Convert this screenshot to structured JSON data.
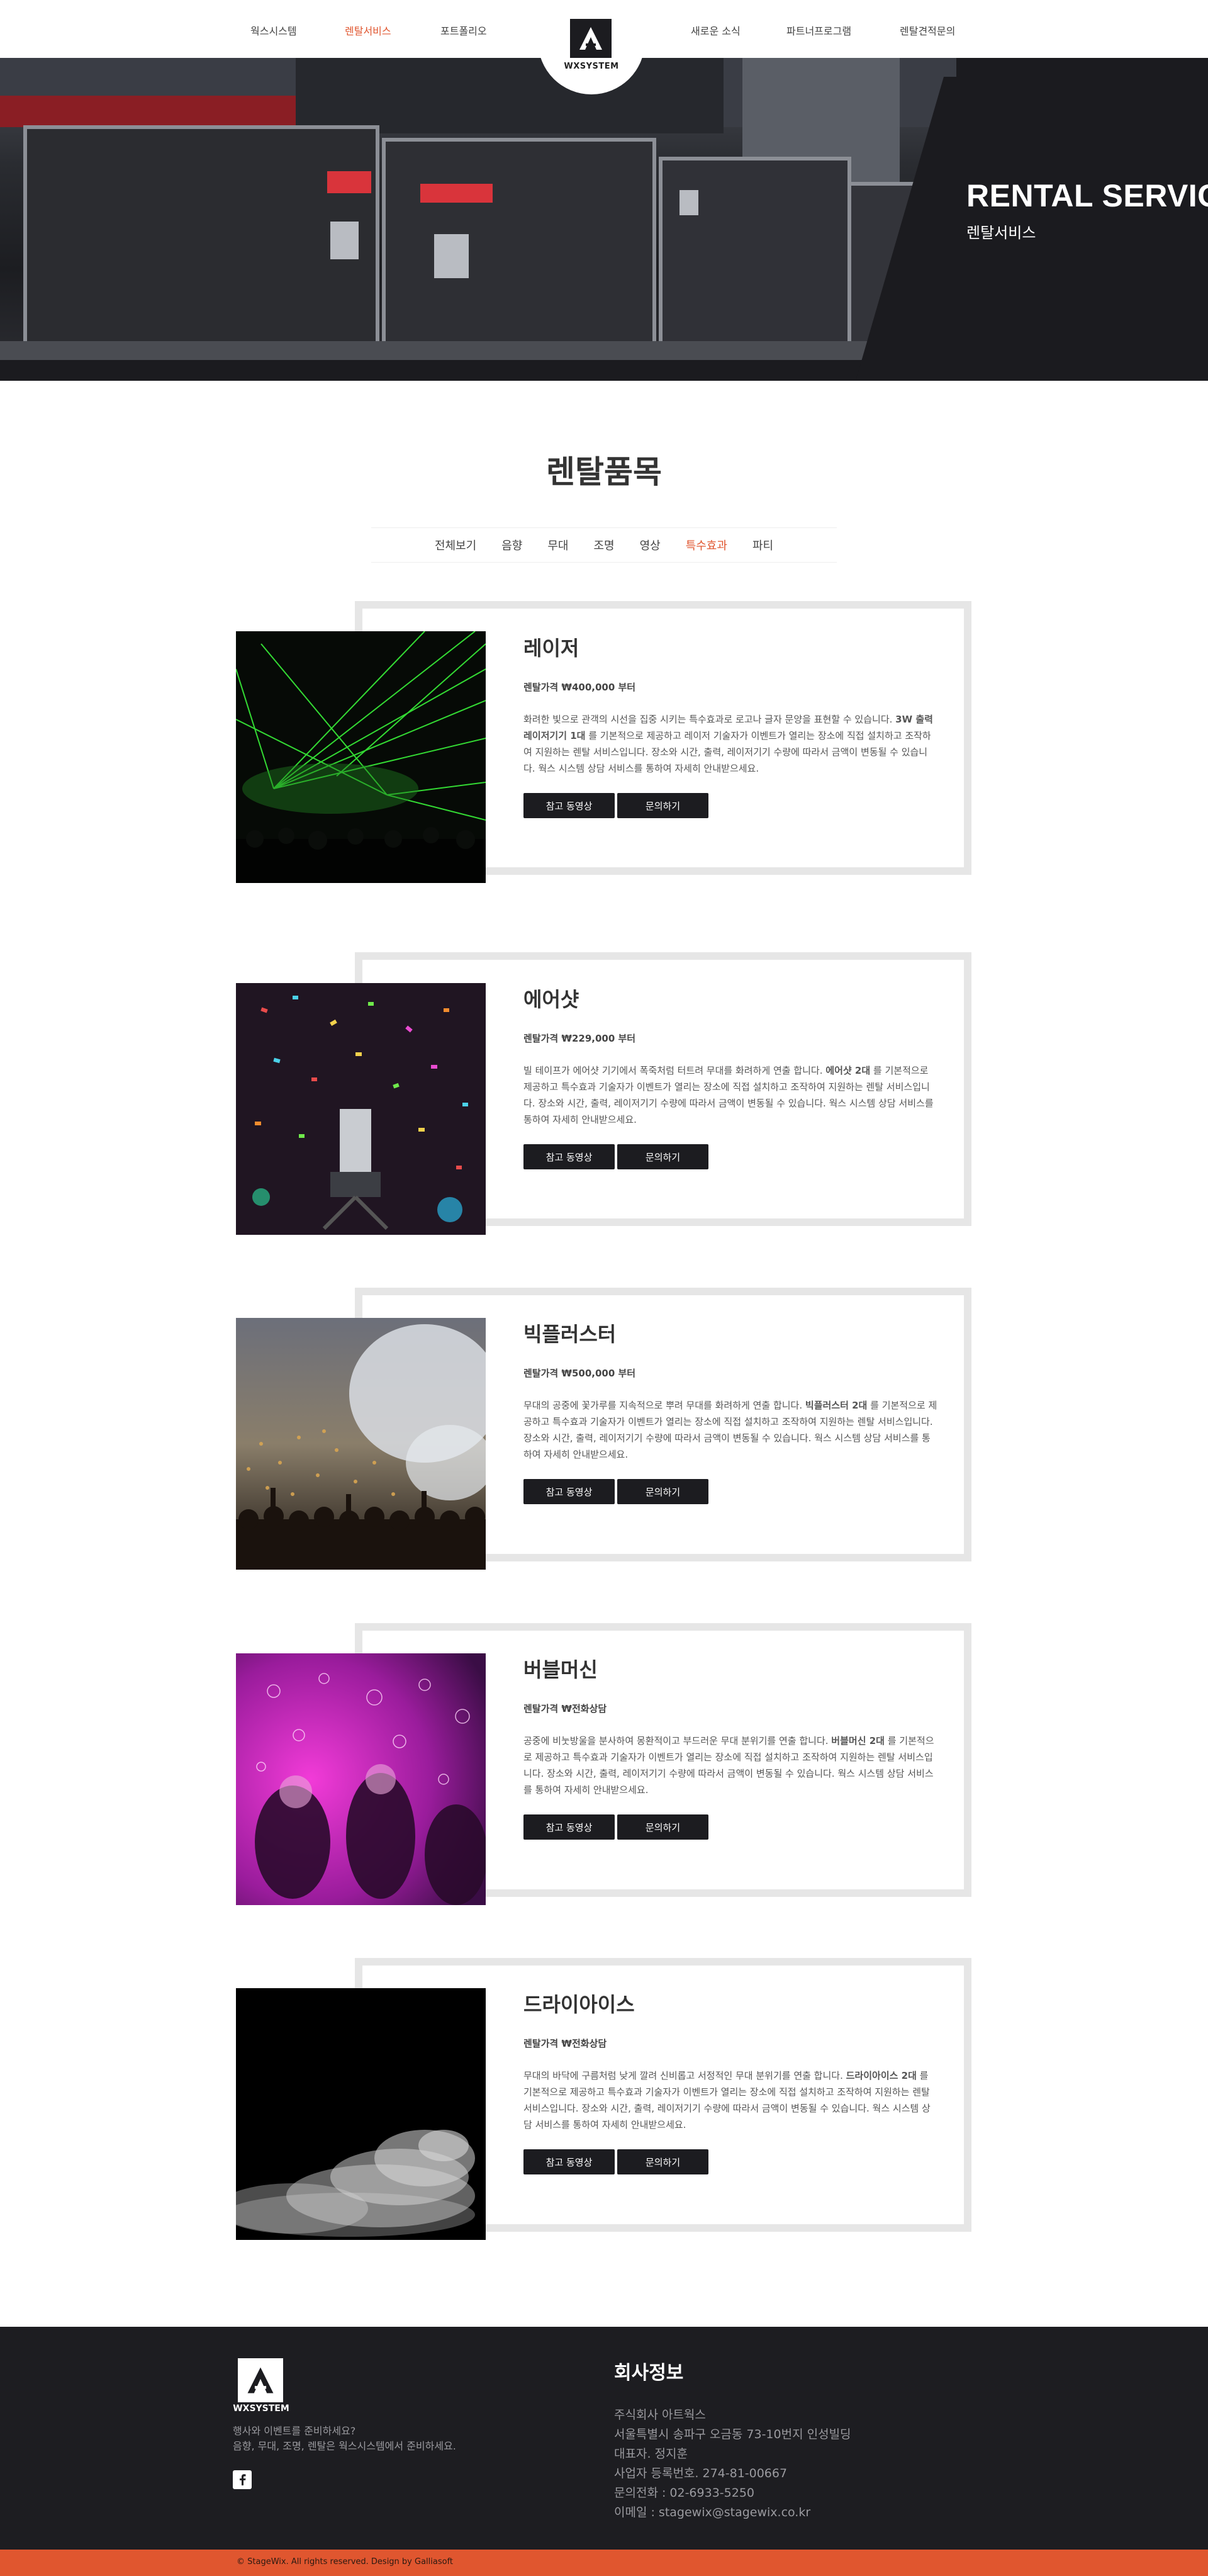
{
  "nav": {
    "left": [
      "웍스시스템",
      "렌탈서비스",
      "포트폴리오"
    ],
    "right": [
      "새로운 소식",
      "파트너프로그램",
      "렌탈견적문의"
    ],
    "active": "렌탈서비스",
    "logo_text": "WXSYSTEM"
  },
  "hero": {
    "title": "RENTAL SERVICE",
    "subtitle": "렌탈서비스"
  },
  "section": {
    "title": "렌탈품목",
    "tabs": [
      "전체보기",
      "음향",
      "무대",
      "조명",
      "영상",
      "특수효과",
      "파티"
    ],
    "active_tab": "특수효과"
  },
  "products": [
    {
      "name": "레이저",
      "price": "렌탈가격 ₩400,000 부터",
      "desc_before": "화려한 빛으로 관객의 시선을 집중 시키는 특수효과로 로고나 글자 문양을 표현할 수 있습니다. ",
      "desc_bold": "3W 출력 레이저기기 1대",
      "desc_after": " 를 기본적으로 제공하고 레이저 기술자가 이벤트가 열리는 장소에 직접 설치하고 조작하여 지원하는 렌탈 서비스입니다. 장소와 시간, 출력, 레이저기기 수량에 따라서 금액이 변동될 수 있습니다. 웍스 시스템 상담 서비스를 통하여 자세히 안내받으세요.",
      "image": "green-laser-stage-photo"
    },
    {
      "name": "에어샷",
      "price": "렌탈가격 ₩229,000 부터",
      "desc_before": "빌 테이프가 에어샷 기기에서 폭죽처럼 터트려 무대를 화려하게 연출 합니다. ",
      "desc_bold": "에어샷 2대",
      "desc_after": " 를 기본적으로 제공하고 특수효과 기술자가 이벤트가 열리는 장소에 직접 설치하고 조작하여 지원하는 렌탈 서비스입니다. 장소와 시간, 출력, 레이저기기 수량에 따라서 금액이 변동될 수 있습니다. 웍스 시스템 상담 서비스를 통하여 자세히 안내받으세요.",
      "image": "confetti-cannon-photo"
    },
    {
      "name": "빅플러스터",
      "price": "렌탈가격 ₩500,000 부터",
      "desc_before": "무대의 공중에 꽃가루를 지속적으로 뿌려 무대를 화려하게 연출 합니다. ",
      "desc_bold": "빅플러스터 2대",
      "desc_after": " 를 기본적으로 제공하고 특수효과 기술자가 이벤트가 열리는 장소에 직접 설치하고 조작하여 지원하는 렌탈 서비스입니다. 장소와 시간, 출력, 레이저기기 수량에 따라서 금액이 변동될 수 있습니다. 웍스 시스템 상담 서비스를 통하여 자세히 안내받으세요.",
      "image": "confetti-crowd-photo"
    },
    {
      "name": "버블머신",
      "price": "렌탈가격 ₩전화상담",
      "desc_before": "공중에 비눗방울을 분사하여 몽환적이고 부드러운 무대 분위기를 연출 합니다. ",
      "desc_bold": "버블머신 2대",
      "desc_after": " 를 기본적으로 제공하고 특수효과 기술자가 이벤트가 열리는 장소에 직접 설치하고 조작하여 지원하는 렌탈 서비스입니다. 장소와 시간, 출력, 레이저기기 수량에 따라서 금액이 변동될 수 있습니다. 웍스 시스템 상담 서비스를 통하여 자세히 안내받으세요.",
      "image": "bubble-party-photo"
    },
    {
      "name": "드라이아이스",
      "price": "렌탈가격 ₩전화상담",
      "desc_before": "무대의 바닥에 구름처럼 낮게 깔려 신비롭고 서정적인 무대 분위기를 연출 합니다. ",
      "desc_bold": "드라이아이스 2대",
      "desc_after": " 를 기본적으로 제공하고 특수효과 기술자가 이벤트가 열리는 장소에 직접 설치하고 조작하여 지원하는 렌탈 서비스입니다. 장소와 시간, 출력, 레이저기기 수량에 따라서 금액이 변동될 수 있습니다. 웍스 시스템 상담 서비스를 통하여 자세히 안내받으세요.",
      "image": "dry-ice-smoke-photo"
    }
  ],
  "buttons": {
    "video": "참고 동영상",
    "inquiry": "문의하기"
  },
  "footer": {
    "logo_text": "WXSYSTEM",
    "tagline_1": "행사와 이벤트를 준비하세요?",
    "tagline_2": "음향, 무대, 조명, 렌탈은 웍스시스템에서 준비하세요.",
    "heading": "회사정보",
    "info": [
      "주식회사 아트웍스",
      "서울특별시 송파구 오금동 73-10번지 인성빌딩",
      "대표자. 정지훈",
      "사업자 등록번호. 274-81-00667",
      "문의전화 : 02-6933-5250",
      "이메일 : stagewix@stagewix.co.kr"
    ],
    "copyright": "© StageWix. All rights reserved. Design by Galliasoft"
  },
  "colors": {
    "accent": "#e0562f",
    "dark": "#1c1c20",
    "card_border": "#e6e6e6"
  }
}
